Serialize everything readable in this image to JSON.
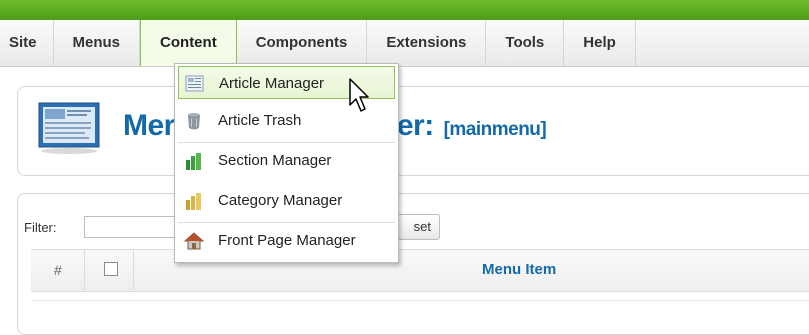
{
  "menubar": {
    "items": [
      "Site",
      "Menus",
      "Content",
      "Components",
      "Extensions",
      "Tools",
      "Help"
    ],
    "active": "Content"
  },
  "dropdown": {
    "items": [
      {
        "label": "Article Manager",
        "icon": "article-manager-icon"
      },
      {
        "label": "Article Trash",
        "icon": "trash-icon"
      },
      {
        "label": "Section Manager",
        "icon": "section-manager-icon"
      },
      {
        "label": "Category Manager",
        "icon": "category-manager-icon"
      },
      {
        "label": "Front Page Manager",
        "icon": "front-page-icon"
      }
    ],
    "hovered": "Article Manager"
  },
  "page": {
    "title_start": "Mer",
    "title_end": "er:",
    "title_suffix": "[mainmenu]"
  },
  "filter": {
    "label": "Filter:",
    "value": "",
    "reset_label": "set"
  },
  "table": {
    "col_num": "#",
    "col_menu_item": "Menu Item"
  },
  "colors": {
    "topbar_green": "#5aab22",
    "title_blue": "#146aa9",
    "hover_border": "#8fc45a"
  }
}
